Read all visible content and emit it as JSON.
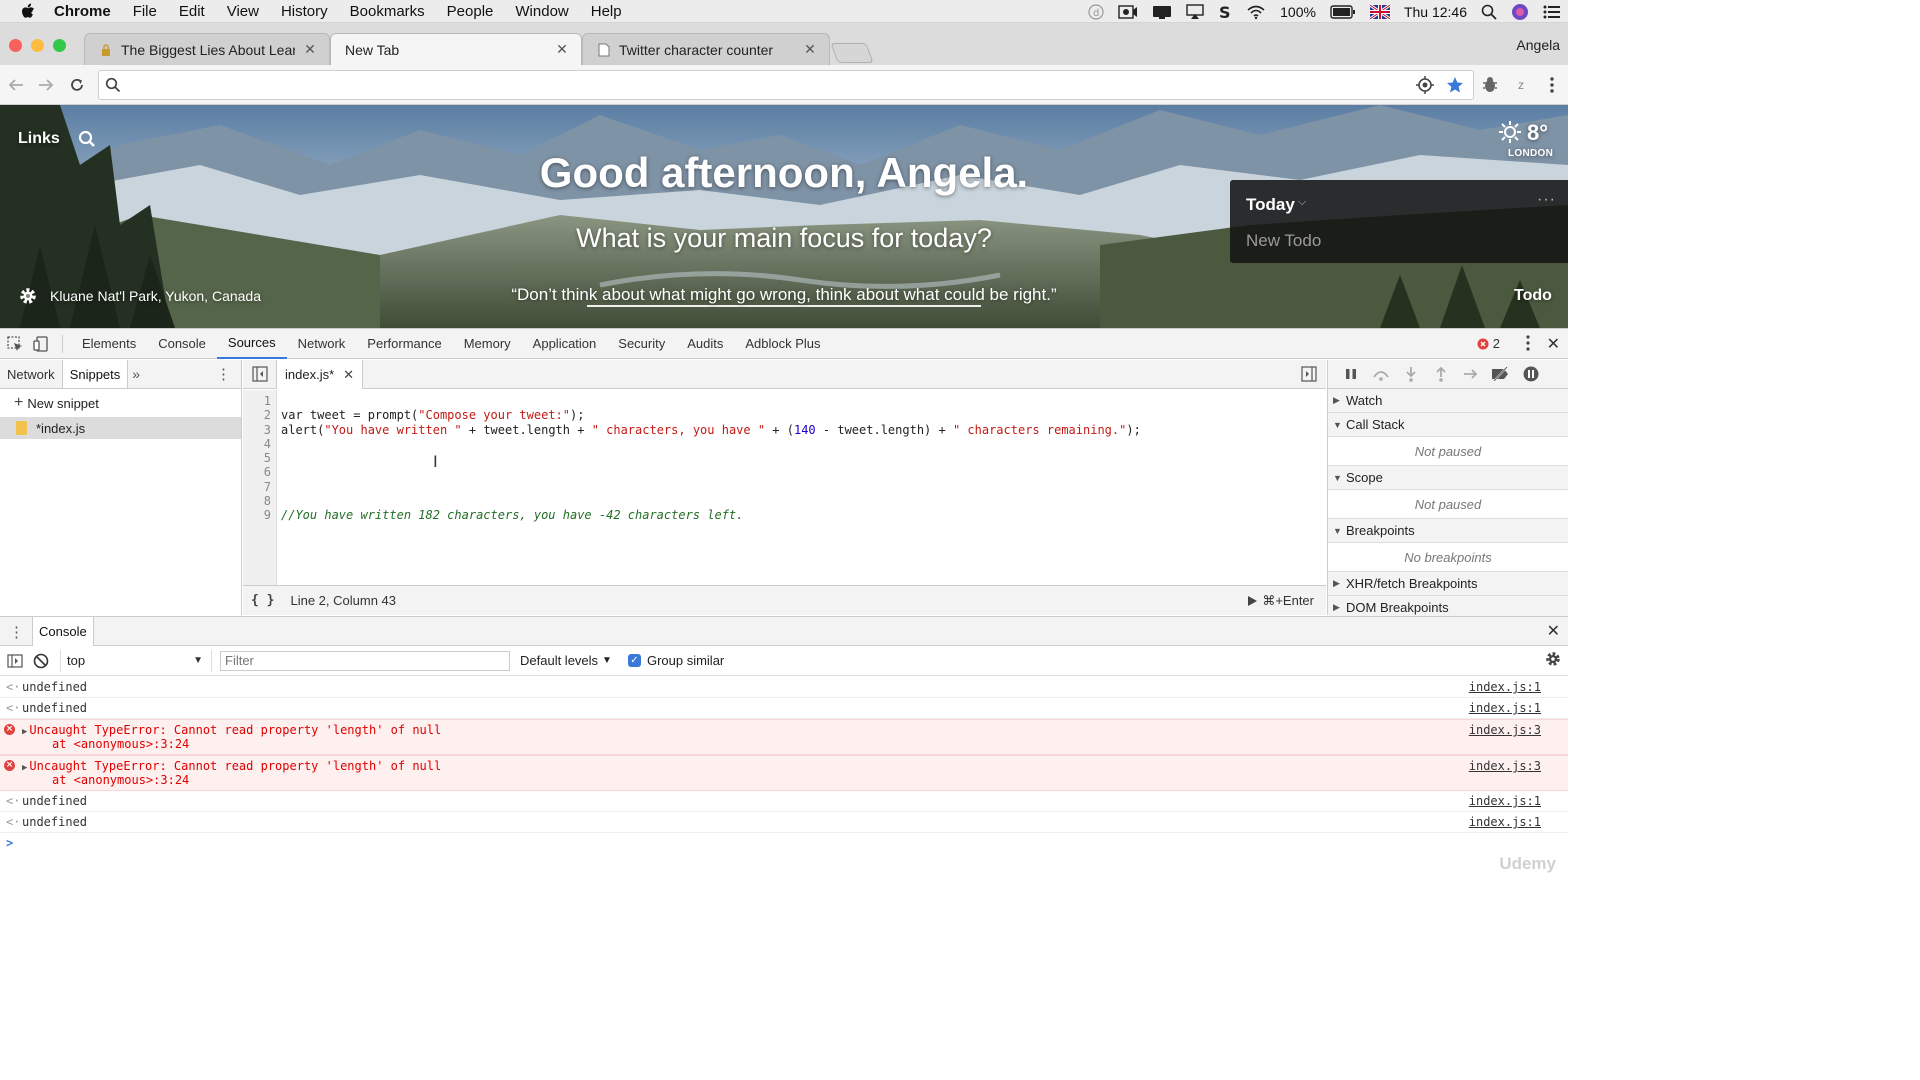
{
  "menubar": {
    "app": "Chrome",
    "items": [
      "File",
      "Edit",
      "View",
      "History",
      "Bookmarks",
      "People",
      "Window",
      "Help"
    ],
    "battery": "100%",
    "clock": "Thu 12:46"
  },
  "tabs": {
    "items": [
      {
        "label": "The Biggest Lies About Learnin"
      },
      {
        "label": "New Tab"
      },
      {
        "label": "Twitter character counter"
      }
    ],
    "profile": "Angela"
  },
  "omnibox": {
    "value": ""
  },
  "ntp": {
    "links": "Links",
    "greeting": "Good afternoon, Angela.",
    "focus_question": "What is your main focus for today?",
    "quote": "“Don’t think about what might go wrong, think about what could be right.”",
    "location": "Kluane Nat'l Park, Yukon, Canada",
    "weather_temp": "8°",
    "weather_city": "LONDON",
    "todo_label": "Todo",
    "todo_panel": {
      "title": "Today",
      "more": "···",
      "new_todo": "New Todo"
    }
  },
  "devtools": {
    "tabs": [
      "Elements",
      "Console",
      "Sources",
      "Network",
      "Performance",
      "Memory",
      "Application",
      "Security",
      "Audits",
      "Adblock Plus"
    ],
    "active_tab": "Sources",
    "error_count": "2",
    "navigator": {
      "tabs": [
        "Network",
        "Snippets"
      ],
      "more": "»",
      "new_snippet": "New snippet",
      "file": "*index.js"
    },
    "editor": {
      "file_tab": "index.js*",
      "line_numbers": [
        "1",
        "2",
        "3",
        "4",
        "5",
        "6",
        "7",
        "8",
        "9"
      ],
      "status_position": "Line 2, Column 43",
      "run_hint": "⌘+Enter",
      "code": {
        "l2_kw": "var",
        "l2_a": " tweet = prompt(",
        "l2_str": "\"Compose your tweet:\"",
        "l2_end": ");",
        "l3_a": "alert(",
        "l3_s1": "\"You have written \"",
        "l3_b": " + tweet.length + ",
        "l3_s2": "\" characters, you have \"",
        "l3_c": " + (",
        "l3_num": "140",
        "l3_d": " - tweet.length) + ",
        "l3_s3": "\" characters remaining.\"",
        "l3_end": ");",
        "l9_cmt": "//You have written 182 characters, you have -42 characters left."
      }
    },
    "debugger": {
      "watch": "Watch",
      "call_stack": "Call Stack",
      "call_stack_body": "Not paused",
      "scope": "Scope",
      "scope_body": "Not paused",
      "breakpoints": "Breakpoints",
      "breakpoints_body": "No breakpoints",
      "xhr": "XHR/fetch Breakpoints",
      "dom": "DOM Breakpoints"
    },
    "console": {
      "tab": "Console",
      "context": "top",
      "filter_placeholder": "Filter",
      "levels": "Default levels",
      "group_similar": "Group similar",
      "messages": [
        {
          "type": "result",
          "text": "undefined",
          "source": "index.js:1"
        },
        {
          "type": "result",
          "text": "undefined",
          "source": "index.js:1"
        },
        {
          "type": "error",
          "text": "Uncaught TypeError: Cannot read property 'length' of null",
          "stack": "at <anonymous>:3:24",
          "source": "index.js:3"
        },
        {
          "type": "error",
          "text": "Uncaught TypeError: Cannot read property 'length' of null",
          "stack": "at <anonymous>:3:24",
          "source": "index.js:3"
        },
        {
          "type": "result",
          "text": "undefined",
          "source": "index.js:1"
        },
        {
          "type": "result",
          "text": "undefined",
          "source": "index.js:1"
        }
      ],
      "prompt": ">"
    }
  },
  "watermark": "Udemy",
  "colors": {
    "accent": "#3879d9",
    "error_red": "#e0423e",
    "string_red": "#c41a16",
    "number_blue": "#1c00cf",
    "comment_green": "#236e25",
    "traffic_red": "#fc605c",
    "traffic_yellow": "#fdbc40",
    "traffic_green": "#34c84a"
  }
}
